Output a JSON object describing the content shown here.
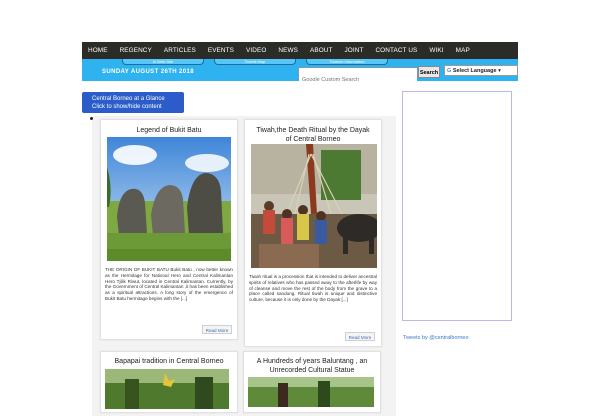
{
  "nav": {
    "items": [
      "HOME",
      "REGENCY",
      "ARTICLES",
      "EVENTS",
      "VIDEO",
      "NEWS",
      "ABOUT",
      "JOINT",
      "CONTACT US",
      "WIKI",
      "MAP"
    ]
  },
  "subbar": {
    "tabs": [
      "In Web Site",
      "Tourist Map",
      "Tourism Information"
    ],
    "date": "SUNDAY AUGUST 26TH 2018",
    "search_placeholder": "Google Custom Search",
    "search_button": "Search",
    "language": "Select Language"
  },
  "glance": {
    "line1": "Central Borneo at a Glance",
    "line2": "Click to show/hide content"
  },
  "cards": [
    {
      "title": "Legend of Bukit Batu",
      "text": "THE ORIGIN OF BUKIT BATU Bukit Batu , now better known as the Hermitage for National Hero and Central Kalimantan Hero Tjilik Riwut, located in Central Kalimantan. Currently, by the Government of Central Kalimantan ,it has been established as a spiritual attractions. A long story of the emergence of Bukit Batu hermitage begins with the [...]",
      "readmore": "Read More"
    },
    {
      "title": "Tiwah,the Death Ritual by the Dayak of Central Borneo",
      "text": "Tiwah ritual is a procession that is intended to deliver ancestral spirits of relatives who has passed away to the afterlife by way of cleanse and move the rest of the body from the grave to a place called sandung. Ritual tiwah is unique and distinctive culture, because it is only done by the Dayak [...]",
      "readmore": "Read More"
    },
    {
      "title": "Bapapai tradition in Central Borneo"
    },
    {
      "title": "A Hundreds of years Baluntang , an Unrecorded Cultural Statue"
    }
  ],
  "sidebar": {
    "tweets_link": "Tweets by @centralborneo"
  },
  "colors": {
    "nav_bg": "#2b2b27",
    "subbar_bg": "#2fb3f0",
    "glance_bg": "#2b5cc9",
    "link": "#3c78c5"
  }
}
